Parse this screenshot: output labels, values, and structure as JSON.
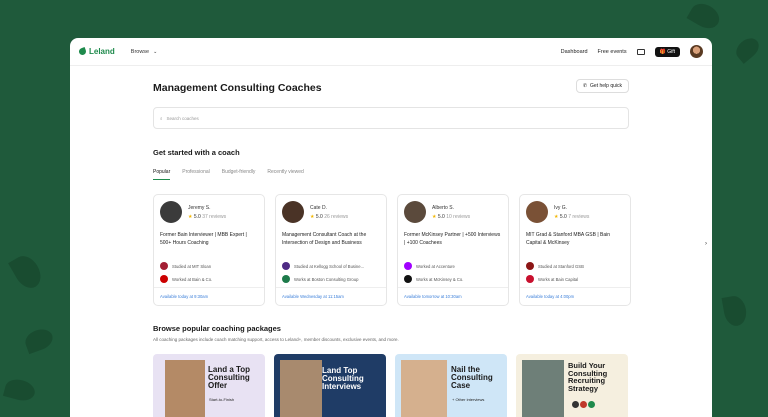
{
  "nav": {
    "logo": "Leland",
    "browse": "Browse",
    "dashboard": "Dashboard",
    "free_events": "Free events",
    "gift": "Gift"
  },
  "header": {
    "title": "Management Consulting Coaches",
    "help": "Get help quick",
    "search_placeholder": "Search coaches"
  },
  "coaches_section": {
    "title": "Get started with a coach",
    "tabs": [
      "Popular",
      "Professional",
      "Budget-friendly",
      "Recently viewed"
    ]
  },
  "coaches": [
    {
      "name": "Jeremy S.",
      "rating": "5.0",
      "reviews": "37 reviews",
      "headline": "Former Bain Interviewer | MBB Expert | 500+ Hours Coaching",
      "line1": "Studied at MIT Sloan",
      "line2": "Worked at Bain & Co.",
      "availability": "Available today at 9:30am",
      "avatar_color": "#3b3b3b",
      "logo1_color": "#a31f34",
      "logo2_color": "#cc0000"
    },
    {
      "name": "Cate D.",
      "rating": "5.0",
      "reviews": "26 reviews",
      "headline": "Management Consultant Coach at the Intersection of Design and Business",
      "line1": "Studied at Kellogg School of Busine...",
      "line2": "Works at Boston Consulting Group",
      "availability": "Available Wednesday at 11:15am",
      "avatar_color": "#4a3326",
      "logo1_color": "#4e2a84",
      "logo2_color": "#1d7a4a"
    },
    {
      "name": "Alberto S.",
      "rating": "5.0",
      "reviews": "10 reviews",
      "headline": "Former McKinsey Partner | +500 Interviews | +100 Coachees",
      "line1": "Worked at Accenture",
      "line2": "Works at McKinsey & Co.",
      "availability": "Available tomorrow at 10:30am",
      "avatar_color": "#5b4a3c",
      "logo1_color": "#a100ff",
      "logo2_color": "#111111"
    },
    {
      "name": "Ivy G.",
      "rating": "5.0",
      "reviews": "7 reviews",
      "headline": "MIT Grad & Stanford MBA GSB | Bain Capital & McKinsey",
      "line1": "Studied at Stanford GSB",
      "line2": "Works at Bain Capital",
      "availability": "Available today at 4:00pm",
      "avatar_color": "#7a5136",
      "logo1_color": "#8c1515",
      "logo2_color": "#c8102e"
    }
  ],
  "packages": {
    "title": "Browse popular coaching packages",
    "subtitle": "All coaching packages include coach matching support, access to Leland+, member discounts, exclusive events, and more.",
    "items": [
      {
        "title": "Land a Top Consulting Offer",
        "tag": "Start-to-Finish",
        "bg": "#e8e2f3"
      },
      {
        "title": "Land Top Consulting Interviews",
        "tag": "",
        "bg": "#1f3c66"
      },
      {
        "title": "Nail the Consulting Case",
        "tag": "+ Other interviews",
        "bg": "#cfe6f7"
      },
      {
        "title": "Build Your Consulting Recruiting Strategy",
        "tag": "",
        "bg": "#f5efdf"
      }
    ]
  },
  "colors": {
    "background": "#1f5a3b",
    "brand": "#1e8a4c",
    "link": "#3b7fd9"
  }
}
